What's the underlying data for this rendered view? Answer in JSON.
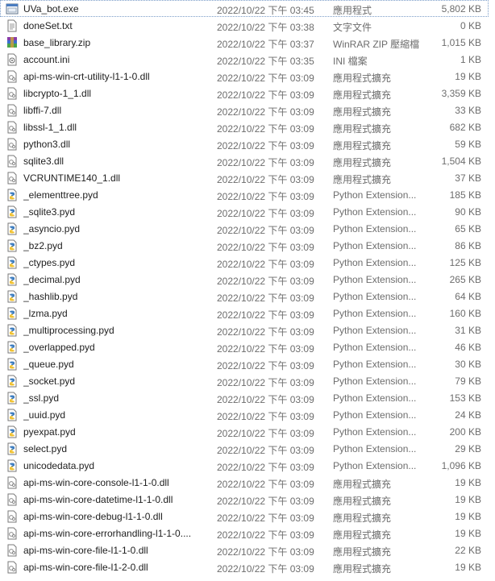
{
  "files": [
    {
      "name": "UVa_bot.exe",
      "date": "2022/10/22 下午 03:45",
      "type": "應用程式",
      "size": "5,802 KB",
      "icon": "exe-icon"
    },
    {
      "name": "doneSet.txt",
      "date": "2022/10/22 下午 03:38",
      "type": "文字文件",
      "size": "0 KB",
      "icon": "txt-icon"
    },
    {
      "name": "base_library.zip",
      "date": "2022/10/22 下午 03:37",
      "type": "WinRAR ZIP 壓縮檔",
      "size": "1,015 KB",
      "icon": "zip-icon"
    },
    {
      "name": "account.ini",
      "date": "2022/10/22 下午 03:35",
      "type": "INI 檔案",
      "size": "1 KB",
      "icon": "ini-icon"
    },
    {
      "name": "api-ms-win-crt-utility-l1-1-0.dll",
      "date": "2022/10/22 下午 03:09",
      "type": "應用程式擴充",
      "size": "19 KB",
      "icon": "dll-icon"
    },
    {
      "name": "libcrypto-1_1.dll",
      "date": "2022/10/22 下午 03:09",
      "type": "應用程式擴充",
      "size": "3,359 KB",
      "icon": "dll-icon"
    },
    {
      "name": "libffi-7.dll",
      "date": "2022/10/22 下午 03:09",
      "type": "應用程式擴充",
      "size": "33 KB",
      "icon": "dll-icon"
    },
    {
      "name": "libssl-1_1.dll",
      "date": "2022/10/22 下午 03:09",
      "type": "應用程式擴充",
      "size": "682 KB",
      "icon": "dll-icon"
    },
    {
      "name": "python3.dll",
      "date": "2022/10/22 下午 03:09",
      "type": "應用程式擴充",
      "size": "59 KB",
      "icon": "dll-icon"
    },
    {
      "name": "sqlite3.dll",
      "date": "2022/10/22 下午 03:09",
      "type": "應用程式擴充",
      "size": "1,504 KB",
      "icon": "dll-icon"
    },
    {
      "name": "VCRUNTIME140_1.dll",
      "date": "2022/10/22 下午 03:09",
      "type": "應用程式擴充",
      "size": "37 KB",
      "icon": "dll-icon"
    },
    {
      "name": "_elementtree.pyd",
      "date": "2022/10/22 下午 03:09",
      "type": "Python Extension...",
      "size": "185 KB",
      "icon": "pyd-icon"
    },
    {
      "name": "_sqlite3.pyd",
      "date": "2022/10/22 下午 03:09",
      "type": "Python Extension...",
      "size": "90 KB",
      "icon": "pyd-icon"
    },
    {
      "name": "_asyncio.pyd",
      "date": "2022/10/22 下午 03:09",
      "type": "Python Extension...",
      "size": "65 KB",
      "icon": "pyd-icon"
    },
    {
      "name": "_bz2.pyd",
      "date": "2022/10/22 下午 03:09",
      "type": "Python Extension...",
      "size": "86 KB",
      "icon": "pyd-icon"
    },
    {
      "name": "_ctypes.pyd",
      "date": "2022/10/22 下午 03:09",
      "type": "Python Extension...",
      "size": "125 KB",
      "icon": "pyd-icon"
    },
    {
      "name": "_decimal.pyd",
      "date": "2022/10/22 下午 03:09",
      "type": "Python Extension...",
      "size": "265 KB",
      "icon": "pyd-icon"
    },
    {
      "name": "_hashlib.pyd",
      "date": "2022/10/22 下午 03:09",
      "type": "Python Extension...",
      "size": "64 KB",
      "icon": "pyd-icon"
    },
    {
      "name": "_lzma.pyd",
      "date": "2022/10/22 下午 03:09",
      "type": "Python Extension...",
      "size": "160 KB",
      "icon": "pyd-icon"
    },
    {
      "name": "_multiprocessing.pyd",
      "date": "2022/10/22 下午 03:09",
      "type": "Python Extension...",
      "size": "31 KB",
      "icon": "pyd-icon"
    },
    {
      "name": "_overlapped.pyd",
      "date": "2022/10/22 下午 03:09",
      "type": "Python Extension...",
      "size": "46 KB",
      "icon": "pyd-icon"
    },
    {
      "name": "_queue.pyd",
      "date": "2022/10/22 下午 03:09",
      "type": "Python Extension...",
      "size": "30 KB",
      "icon": "pyd-icon"
    },
    {
      "name": "_socket.pyd",
      "date": "2022/10/22 下午 03:09",
      "type": "Python Extension...",
      "size": "79 KB",
      "icon": "pyd-icon"
    },
    {
      "name": "_ssl.pyd",
      "date": "2022/10/22 下午 03:09",
      "type": "Python Extension...",
      "size": "153 KB",
      "icon": "pyd-icon"
    },
    {
      "name": "_uuid.pyd",
      "date": "2022/10/22 下午 03:09",
      "type": "Python Extension...",
      "size": "24 KB",
      "icon": "pyd-icon"
    },
    {
      "name": "pyexpat.pyd",
      "date": "2022/10/22 下午 03:09",
      "type": "Python Extension...",
      "size": "200 KB",
      "icon": "pyd-icon"
    },
    {
      "name": "select.pyd",
      "date": "2022/10/22 下午 03:09",
      "type": "Python Extension...",
      "size": "29 KB",
      "icon": "pyd-icon"
    },
    {
      "name": "unicodedata.pyd",
      "date": "2022/10/22 下午 03:09",
      "type": "Python Extension...",
      "size": "1,096 KB",
      "icon": "pyd-icon"
    },
    {
      "name": "api-ms-win-core-console-l1-1-0.dll",
      "date": "2022/10/22 下午 03:09",
      "type": "應用程式擴充",
      "size": "19 KB",
      "icon": "dll-icon"
    },
    {
      "name": "api-ms-win-core-datetime-l1-1-0.dll",
      "date": "2022/10/22 下午 03:09",
      "type": "應用程式擴充",
      "size": "19 KB",
      "icon": "dll-icon"
    },
    {
      "name": "api-ms-win-core-debug-l1-1-0.dll",
      "date": "2022/10/22 下午 03:09",
      "type": "應用程式擴充",
      "size": "19 KB",
      "icon": "dll-icon"
    },
    {
      "name": "api-ms-win-core-errorhandling-l1-1-0....",
      "date": "2022/10/22 下午 03:09",
      "type": "應用程式擴充",
      "size": "19 KB",
      "icon": "dll-icon"
    },
    {
      "name": "api-ms-win-core-file-l1-1-0.dll",
      "date": "2022/10/22 下午 03:09",
      "type": "應用程式擴充",
      "size": "22 KB",
      "icon": "dll-icon"
    },
    {
      "name": "api-ms-win-core-file-l1-2-0.dll",
      "date": "2022/10/22 下午 03:09",
      "type": "應用程式擴充",
      "size": "19 KB",
      "icon": "dll-icon"
    }
  ]
}
